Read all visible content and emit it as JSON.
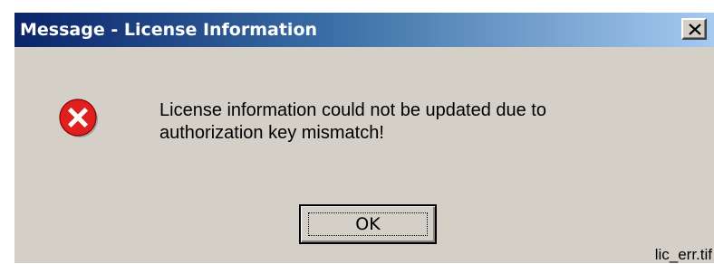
{
  "window": {
    "title": "Message - License Information",
    "close_label": "X"
  },
  "dialog": {
    "icon": "error-icon",
    "message": "License information could not be updated due to\nauthorization key mismatch!",
    "ok_label": "OK"
  },
  "caption": {
    "filename": "lic_err.tif"
  },
  "colors": {
    "title_gradient_start": "#0a246a",
    "title_gradient_end": "#a6caf0",
    "dialog_face": "#d4d0c8",
    "error_red": "#e0201e"
  }
}
